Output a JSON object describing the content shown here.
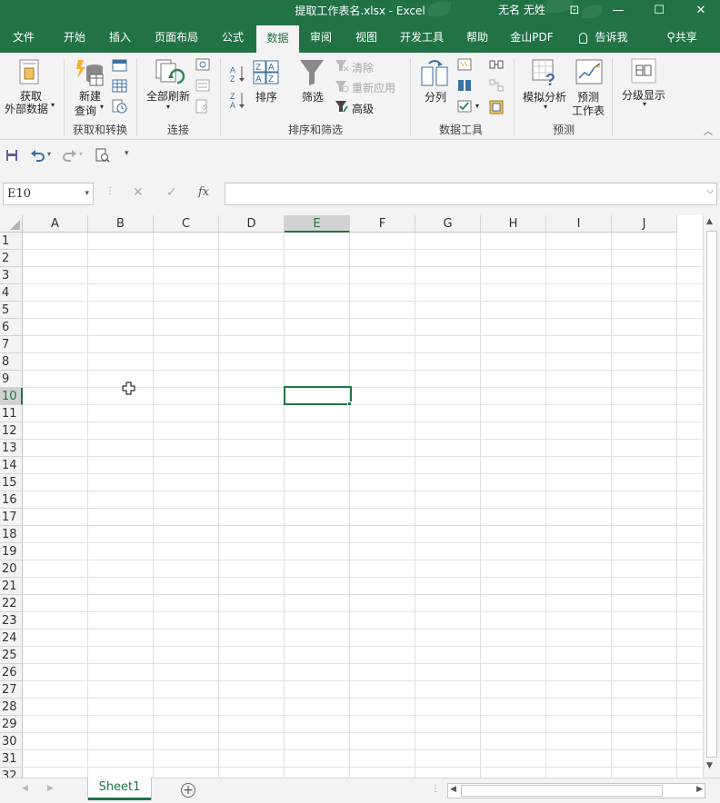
{
  "window": {
    "title": "提取工作表名.xlsx  -  Excel",
    "user": "无名 无姓",
    "minimize": "—",
    "restore": "☐",
    "close": "✕",
    "ribbon_display": "⊡"
  },
  "tabs": [
    {
      "label": "文件"
    },
    {
      "label": "开始"
    },
    {
      "label": "插入"
    },
    {
      "label": "页面布局"
    },
    {
      "label": "公式"
    },
    {
      "label": "数据"
    },
    {
      "label": "审阅"
    },
    {
      "label": "视图"
    },
    {
      "label": "开发工具"
    },
    {
      "label": "帮助"
    },
    {
      "label": "金山PDF"
    },
    {
      "label": "告诉我"
    },
    {
      "label": "共享"
    }
  ],
  "ribbon": {
    "get_external_data_1": "获取",
    "get_external_data_2": "外部数据",
    "new_query_1": "新建",
    "new_query_2": "查询",
    "group_get_transform": "获取和转换",
    "refresh_all": "全部刷新",
    "group_connections": "连接",
    "sort": "排序",
    "filter": "筛选",
    "clear": "清除",
    "reapply": "重新应用",
    "advanced": "高级",
    "group_sort_filter": "排序和筛选",
    "text_to_columns": "分列",
    "group_data_tools": "数据工具",
    "what_if_analysis": "模拟分析",
    "forecast_sheet_1": "预测",
    "forecast_sheet_2": "工作表",
    "group_forecast": "预测",
    "outline": "分级显示"
  },
  "formula_bar": {
    "name_box": "E10",
    "cancel": "✕",
    "enter": "✓",
    "fx": "fx",
    "value": ""
  },
  "grid": {
    "columns": [
      "A",
      "B",
      "C",
      "D",
      "E",
      "F",
      "G",
      "H",
      "I",
      "J"
    ],
    "rows": [
      "1",
      "2",
      "3",
      "4",
      "5",
      "6",
      "7",
      "8",
      "9",
      "10",
      "11",
      "12",
      "13",
      "14",
      "15",
      "16",
      "17",
      "18",
      "19",
      "20",
      "21",
      "22",
      "23",
      "24",
      "25",
      "26",
      "27",
      "28",
      "29",
      "30",
      "31",
      "32"
    ],
    "selected_cell": "E10"
  },
  "sheets": [
    {
      "label": "Sheet1",
      "active": true
    }
  ],
  "colors": {
    "accent": "#217346",
    "ribbon_bg": "#f3f3f3"
  }
}
